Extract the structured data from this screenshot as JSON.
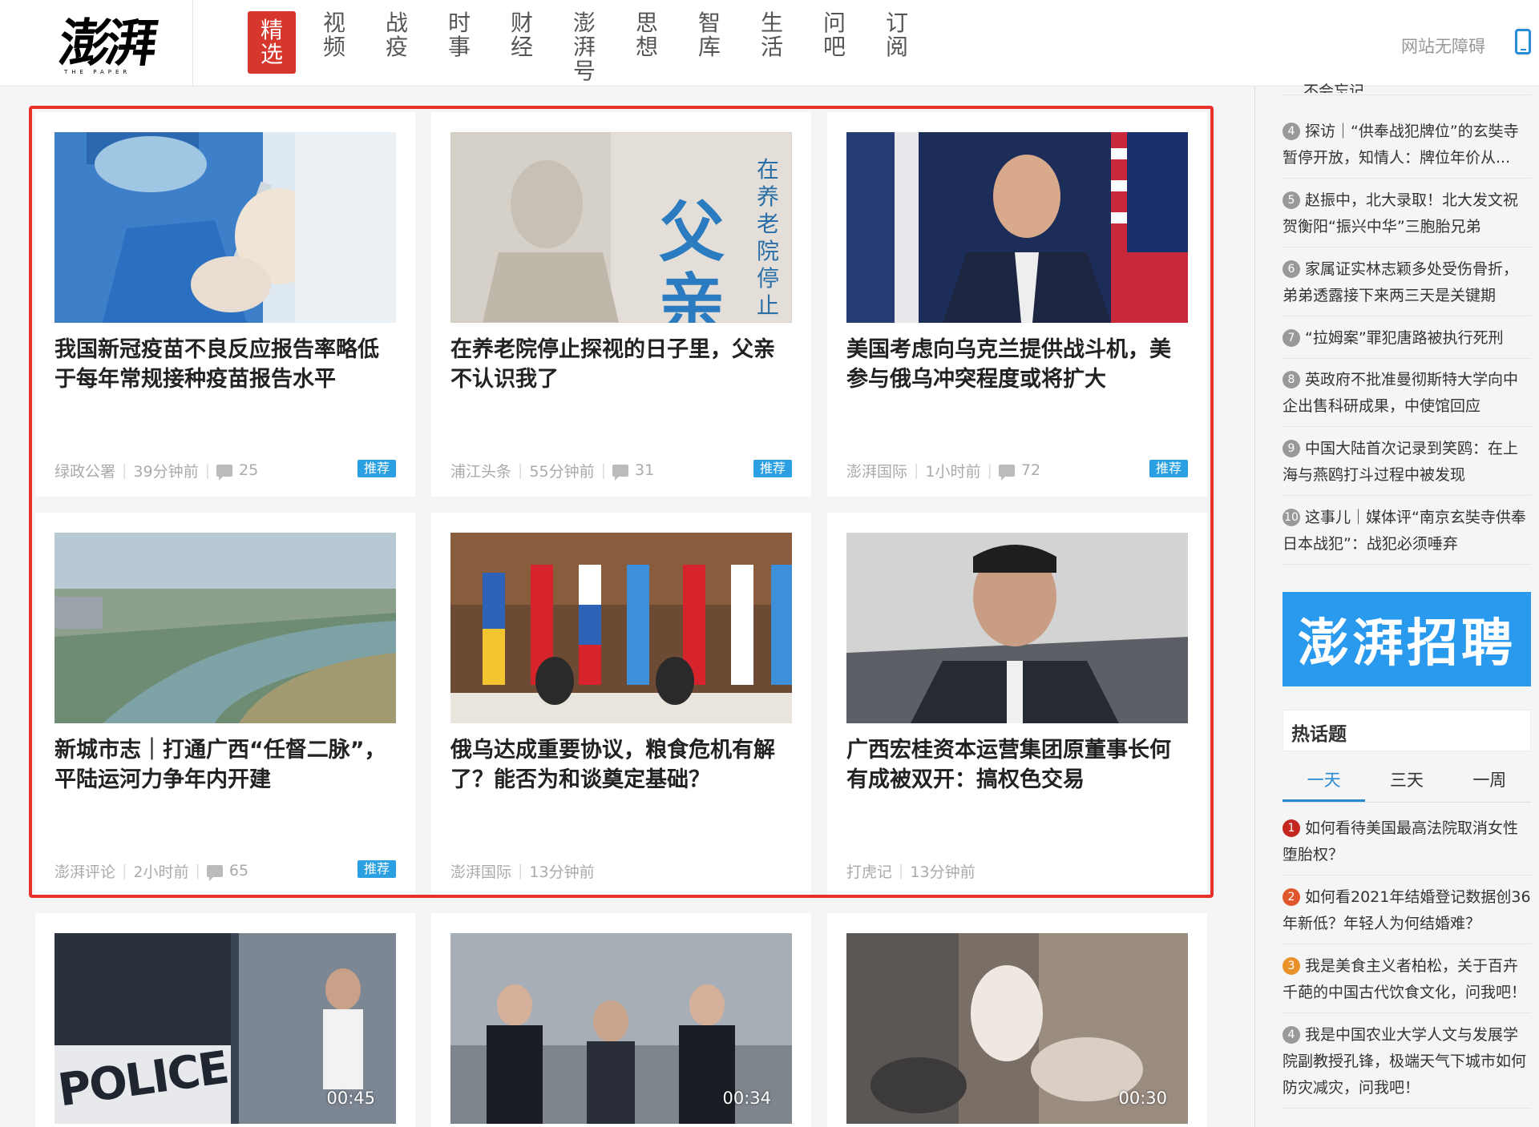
{
  "header": {
    "logo_text": "澎湃",
    "logo_sub": "THE PAPER",
    "nav": [
      "精选",
      "视频",
      "战疫",
      "时事",
      "财经",
      "澎湃号",
      "思想",
      "智库",
      "生活",
      "问吧",
      "订阅"
    ],
    "accessibility": "网站无障碍"
  },
  "cards": [
    {
      "title": "我国新冠疫苗不良反应报告率略低于每年常规接种疫苗报告水平",
      "source": "绿政公署",
      "time": "39分钟前",
      "comments": "25",
      "badge": "推荐"
    },
    {
      "title": "在养老院停止探视的日子里，父亲不认识我了",
      "source": "浦江头条",
      "time": "55分钟前",
      "comments": "31",
      "badge": "推荐",
      "img_text": "在养老院停止",
      "img_big": "父亲"
    },
    {
      "title": "美国考虑向乌克兰提供战斗机，美参与俄乌冲突程度或将扩大",
      "source": "澎湃国际",
      "time": "1小时前",
      "comments": "72",
      "badge": "推荐"
    },
    {
      "title": "新城市志｜打通广西“任督二脉”，平陆运河力争年内开建",
      "source": "澎湃评论",
      "time": "2小时前",
      "comments": "65",
      "badge": "推荐"
    },
    {
      "title": "俄乌达成重要协议，粮食危机有解了？能否为和谈奠定基础？",
      "source": "澎湃国际",
      "time": "13分钟前"
    },
    {
      "title": "广西宏桂资本运营集团原董事长何有成被双开：搞权色交易",
      "source": "打虎记",
      "time": "13分钟前"
    },
    {
      "duration": "00:45",
      "img_text": "POLICE"
    },
    {
      "duration": "00:34"
    },
    {
      "duration": "00:30"
    }
  ],
  "sidebar": {
    "top_partial": "不会忘记",
    "rank": [
      {
        "num": "4",
        "text": "探访｜“供奉战犯牌位”的玄奘寺暂停开放，知情人：牌位年价从..."
      },
      {
        "num": "5",
        "text": "赵振中，北大录取！北大发文祝贺衡阳“振兴中华”三胞胎兄弟"
      },
      {
        "num": "6",
        "text": "家属证实林志颖多处受伤骨折，弟弟透露接下来两三天是关键期"
      },
      {
        "num": "7",
        "text": "“拉姆案”罪犯唐路被执行死刑"
      },
      {
        "num": "8",
        "text": "英政府不批准曼彻斯特大学向中企出售科研成果，中使馆回应"
      },
      {
        "num": "9",
        "text": "中国大陆首次记录到笑鸥：在上海与燕鸥打斗过程中被发现"
      },
      {
        "num": "10",
        "text": "这事儿｜媒体评“南京玄奘寺供奉日本战犯”：战犯必须唾弃"
      }
    ],
    "recruit": "澎湃招聘",
    "hot_title": "热话题",
    "hot_tabs": [
      "一天",
      "三天",
      "一周"
    ],
    "hot": [
      {
        "num": "1",
        "text": "如何看待美国最高法院取消女性堕胎权？"
      },
      {
        "num": "2",
        "text": "如何看2021年结婚登记数据创36年新低？年轻人为何结婚难？"
      },
      {
        "num": "3",
        "text": "我是美食主义者柏松，关于百卉千葩的中国古代饮食文化，问我吧！"
      },
      {
        "num": "4",
        "text": "我是中国农业大学人文与发展学院副教授孔锋，极端天气下城市如何防灾减灾，问我吧！"
      }
    ]
  }
}
